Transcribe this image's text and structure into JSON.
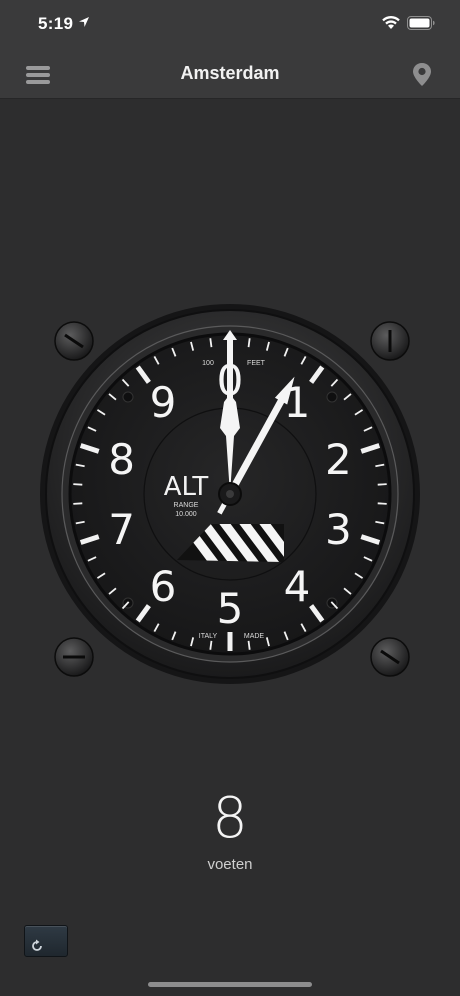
{
  "status_bar": {
    "time": "5:19",
    "icons": [
      "location-arrow-icon",
      "wifi-icon",
      "battery-icon"
    ]
  },
  "nav": {
    "title": "Amsterdam",
    "left_icon": "menu-icon",
    "right_icon": "map-pin-icon"
  },
  "gauge": {
    "center_label": "ALT",
    "range_label": "RANGE",
    "range_value": "10.000",
    "top_scale_label": "100",
    "top_unit_label": "FEET",
    "bottom_left_label": "ITALY",
    "bottom_right_label": "MADE",
    "dial_numbers": [
      "0",
      "1",
      "2",
      "3",
      "4",
      "5",
      "6",
      "7",
      "8",
      "9"
    ],
    "long_hand_value": 0.08,
    "short_hand_value": 0
  },
  "reading": {
    "value": "8",
    "unit": "voeten"
  },
  "controls": {
    "refresh_icon": "refresh-icon"
  },
  "colors": {
    "background": "#2d2d2e",
    "bar": "#3a3a3b",
    "dial": "#1d1d1e",
    "marking": "#ffffff"
  }
}
